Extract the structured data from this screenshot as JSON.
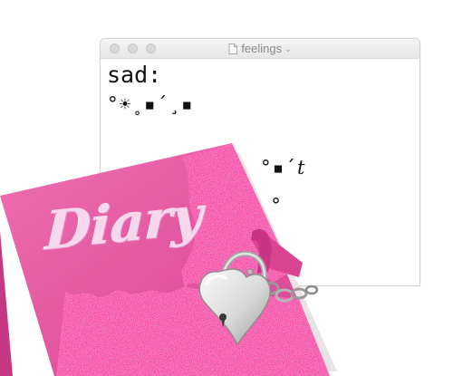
{
  "window": {
    "title": "feelings",
    "chevron": "⌄",
    "lines": {
      "l1": "sad:",
      "l2": "°☀˳▪´¸▪",
      "l3_a": "°▪´",
      "l3_b": "t",
      "l4": "▪˳°"
    }
  },
  "diary": {
    "label": "Diary"
  },
  "colors": {
    "cover": "#e8529f",
    "glitter": "#f03d9c",
    "strap": "#d84a94",
    "lock": "#e4e4e4"
  }
}
